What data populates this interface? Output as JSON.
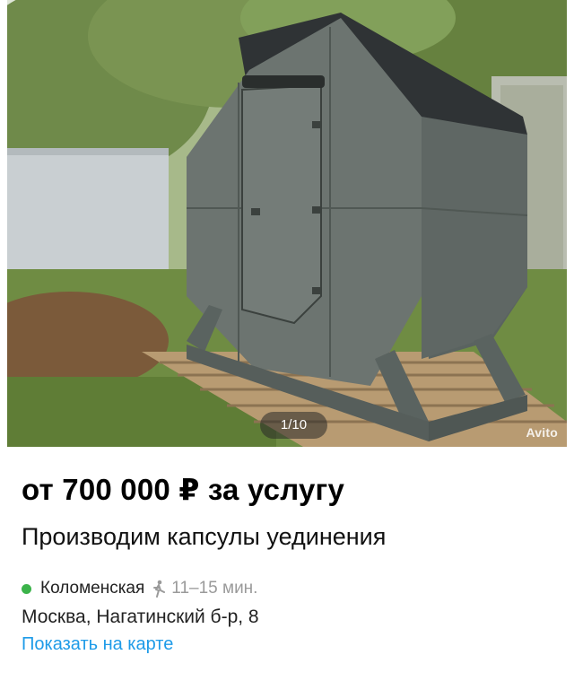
{
  "gallery": {
    "counter": "1/10",
    "watermark": "Avito"
  },
  "listing": {
    "price": "от 700 000 ₽ за услугу",
    "title": "Производим капсулы уединения",
    "metro_station": "Коломенская",
    "walk_time": "11–15 мин.",
    "address": "Москва, Нагатинский б-р, 8",
    "map_link": "Показать на карте"
  },
  "colors": {
    "metro_dot": "#3bb34a",
    "link": "#1e9be8",
    "muted": "#9a9a9a"
  },
  "icons": [
    "walking-person-icon"
  ]
}
